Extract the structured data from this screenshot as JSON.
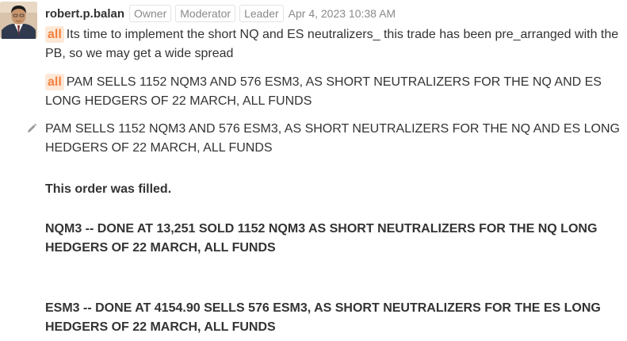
{
  "user": {
    "name": "robert.p.balan",
    "roles": [
      "Owner",
      "Moderator",
      "Leader"
    ],
    "timestamp": "Apr 4, 2023 10:38 AM"
  },
  "messages": [
    {
      "mention": "all",
      "text": "Its time to implement the short NQ and ES neutralizers_ this trade has been pre_arranged with the PB, so we may get a wide spread"
    },
    {
      "mention": "all",
      "text": "PAM SELLS 1152 NQM3 AND 576 ESM3, AS SHORT NEUTRALIZERS FOR THE NQ AND ES LONG HEDGERS OF 22 MARCH, ALL FUNDS"
    }
  ],
  "edited_message": {
    "text": "PAM SELLS 1152 NQM3 AND 576 ESM3, AS SHORT NEUTRALIZERS FOR THE NQ AND ES LONG HEDGERS OF 22 MARCH, ALL FUNDS",
    "filled_note": "This order was filled.",
    "nq_fill": "NQM3 -- DONE AT 13,251 SOLD 1152 NQM3 AS SHORT NEUTRALIZERS FOR THE NQ LONG HEDGERS OF 22 MARCH, ALL FUNDS",
    "es_fill": "ESM3 -- DONE AT 4154.90 SELLS 576 ESM3, AS SHORT NEUTRALIZERS FOR THE ES LONG HEDGERS OF 22 MARCH, ALL FUNDS"
  },
  "icons": {
    "edit": "pencil-icon",
    "avatar": "user-avatar"
  },
  "colors": {
    "mention_text": "#f5803e",
    "mention_bg": "#fde8d7",
    "meta_gray": "#8a8a8a"
  }
}
